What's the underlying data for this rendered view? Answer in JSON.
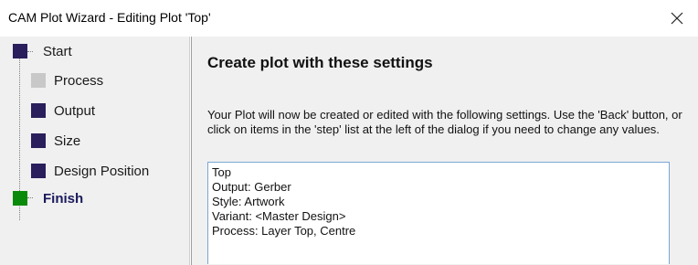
{
  "window": {
    "title": "CAM Plot Wizard - Editing Plot 'Top'",
    "close_icon": "close-icon"
  },
  "steps": [
    {
      "label": "Start",
      "color": "#2a1e5c",
      "state": "done"
    },
    {
      "label": "Process",
      "color": "#c8c8c8",
      "state": "disabled"
    },
    {
      "label": "Output",
      "color": "#2a1e5c",
      "state": "done"
    },
    {
      "label": "Size",
      "color": "#2a1e5c",
      "state": "done"
    },
    {
      "label": "Design Position",
      "color": "#2a1e5c",
      "state": "done"
    },
    {
      "label": "Finish",
      "color": "#0a8a0a",
      "state": "current"
    }
  ],
  "main": {
    "heading": "Create plot with these settings",
    "description": "Your Plot will now be created or edited with the following settings. Use the 'Back' button, or click on items in the 'step' list at the left of the dialog if you need to change any values.",
    "summary_lines": [
      "Top",
      "Output: Gerber",
      "Style: Artwork",
      "Variant: <Master Design>",
      "Process: Layer Top, Centre"
    ]
  }
}
